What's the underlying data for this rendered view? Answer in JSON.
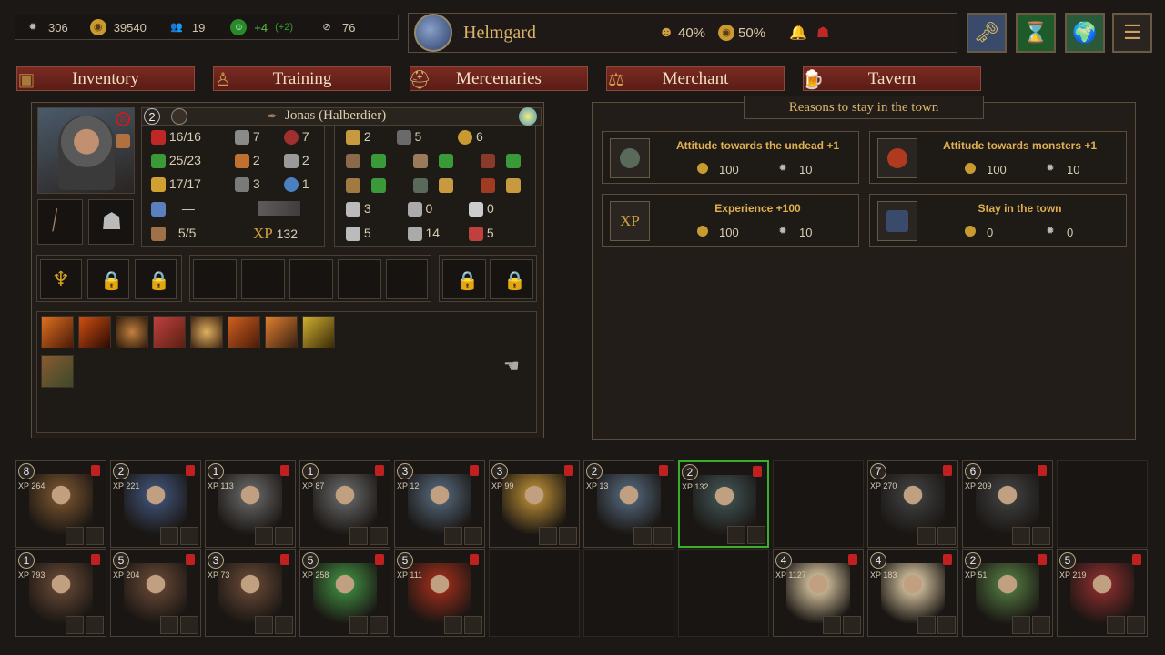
{
  "resources": [
    {
      "icon": "gear-icon",
      "value": "306"
    },
    {
      "icon": "gold-coins-icon",
      "value": "39540"
    },
    {
      "icon": "people-icon",
      "value": "19"
    },
    {
      "icon": "morale-mask-icon",
      "value": "+4",
      "extra": "(+2)"
    },
    {
      "icon": "hidden-eye-icon",
      "value": "76"
    }
  ],
  "town": {
    "name": "Helmgard",
    "morale": "40%",
    "gold": "50%"
  },
  "tabs": [
    "Inventory",
    "Training",
    "Mercenaries",
    "Merchant",
    "Tavern"
  ],
  "hero": {
    "level": "2",
    "name": "Jonas (Halberdier)",
    "stats": {
      "hp": "16/16",
      "attack": "7",
      "accuracy": "7",
      "stamina": "25/23",
      "crit": "2",
      "armor": "2",
      "energy": "17/17",
      "defense": "3",
      "magic_resist": "1",
      "mana": "—",
      "boots": "5/5",
      "xp_label": "XP",
      "xp": "132"
    },
    "relations": {
      "r1": [
        "2",
        "5",
        "6"
      ],
      "r4": [
        "3",
        "0",
        "0"
      ],
      "r5": [
        "5",
        "14",
        "5"
      ]
    }
  },
  "reasons": {
    "title": "Reasons to stay in the town",
    "cards": [
      {
        "title": "Attitude towards the undead +1",
        "gold": "100",
        "gear": "10"
      },
      {
        "title": "Attitude towards monsters +1",
        "gold": "100",
        "gear": "10"
      },
      {
        "title": "Experience +100",
        "gold": "100",
        "gear": "10",
        "icon_text": "XP"
      },
      {
        "title": "Stay in the town",
        "gold": "0",
        "gear": "0"
      }
    ]
  },
  "roster_top": [
    {
      "lvl": "8",
      "xp": "264"
    },
    {
      "lvl": "2",
      "xp": "221"
    },
    {
      "lvl": "1",
      "xp": "113"
    },
    {
      "lvl": "1",
      "xp": "87"
    },
    {
      "lvl": "3",
      "xp": "12"
    },
    {
      "lvl": "3",
      "xp": "99"
    },
    {
      "lvl": "2",
      "xp": "13"
    },
    {
      "lvl": "2",
      "xp": "132"
    },
    {
      "lvl": "7",
      "xp": "270"
    },
    {
      "lvl": "6",
      "xp": "209"
    }
  ],
  "roster_bottom": [
    {
      "lvl": "1",
      "xp": "793"
    },
    {
      "lvl": "5",
      "xp": "204"
    },
    {
      "lvl": "3",
      "xp": "73"
    },
    {
      "lvl": "5",
      "xp": "258"
    },
    {
      "lvl": "5",
      "xp": "111"
    },
    {
      "lvl": "4",
      "xp": "1127"
    },
    {
      "lvl": "4",
      "xp": "183"
    },
    {
      "lvl": "2",
      "xp": "51"
    },
    {
      "lvl": "5",
      "xp": "219"
    }
  ],
  "xp_prefix": "XP",
  "colors": {
    "tab_red": "#6a2019",
    "gold_text": "#e0b050",
    "green_highlight": "#3ab02a"
  }
}
